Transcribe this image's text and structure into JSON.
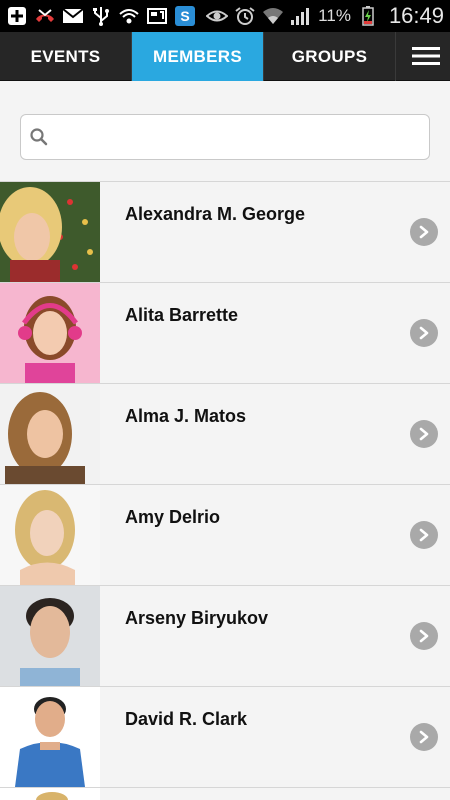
{
  "status_bar": {
    "battery_percent": "11%",
    "time": "16:49",
    "left_icons": [
      "add-icon",
      "missed-call-icon",
      "mail-icon",
      "usb-icon",
      "wifi-signal-icon",
      "sim-card-icon",
      "skype-icon"
    ],
    "right_icons": [
      "eye-icon",
      "alarm-icon",
      "wifi-icon",
      "signal-bars-icon",
      "battery-charging-icon"
    ]
  },
  "tabs": [
    {
      "label": "EVENTS",
      "active": false
    },
    {
      "label": "MEMBERS",
      "active": true
    },
    {
      "label": "GROUPS",
      "active": false
    }
  ],
  "search": {
    "placeholder": "",
    "value": ""
  },
  "members": [
    {
      "name": "Alexandra M. George"
    },
    {
      "name": "Alita Barrette"
    },
    {
      "name": "Alma J. Matos"
    },
    {
      "name": "Amy Delrio"
    },
    {
      "name": "Arseny Biryukov"
    },
    {
      "name": "David R. Clark"
    }
  ],
  "colors": {
    "accent": "#2aa8e0",
    "tabbar": "#262626",
    "background": "#f4f4f4",
    "chevron": "#a9a9a9"
  }
}
